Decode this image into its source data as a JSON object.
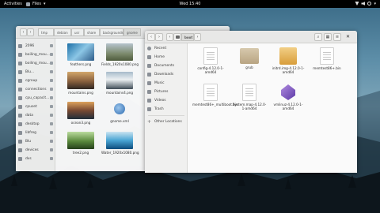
{
  "topbar": {
    "activities": "Activities",
    "app_menu": "Files",
    "clock": "Wed 15:40"
  },
  "back_window": {
    "path": [
      "tmp",
      "debian",
      "usr",
      "share",
      "backgrounds",
      "gnome"
    ],
    "sidebar": [
      "2096",
      "boiling_mou...",
      "boiling_mou...",
      "Blu...",
      "cgroup",
      "connections",
      "cpu_capacit...",
      "cpuset",
      "data",
      "desktop",
      "libfreg",
      "Blu",
      "devices",
      "dvs"
    ],
    "files": [
      {
        "name": "feathers.png",
        "icon": "image-feathers"
      },
      {
        "name": "Fields_1920x1080.png",
        "icon": "image-fields"
      },
      {
        "name": "mountains.png",
        "icon": "image-mountains"
      },
      {
        "name": "mountains4.png",
        "icon": "image-mountains4"
      },
      {
        "name": "ocean3.png",
        "icon": "image-ocean"
      },
      {
        "name": "gnome.xml",
        "icon": "xml-file"
      },
      {
        "name": "tree2.png",
        "icon": "image-tree"
      },
      {
        "name": "Water_1920x1080.png",
        "icon": "image-water"
      }
    ]
  },
  "front_window": {
    "path": [
      "boot"
    ],
    "sidebar": [
      {
        "label": "Recent",
        "icon": "clock-icon"
      },
      {
        "label": "Home",
        "icon": "home-icon"
      },
      {
        "label": "Documents",
        "icon": "documents-icon"
      },
      {
        "label": "Downloads",
        "icon": "downloads-icon"
      },
      {
        "label": "Music",
        "icon": "music-icon"
      },
      {
        "label": "Pictures",
        "icon": "pictures-icon"
      },
      {
        "label": "Videos",
        "icon": "videos-icon"
      },
      {
        "label": "Trash",
        "icon": "trash-icon"
      },
      {
        "label": "Other Locations",
        "icon": "plus-icon"
      }
    ],
    "files": [
      {
        "name": "config-4.12.0-1-amd64",
        "icon": "text-file"
      },
      {
        "name": "grub",
        "icon": "folder"
      },
      {
        "name": "initrd.img-4.12.0-1-amd64",
        "icon": "archive"
      },
      {
        "name": "memtest86+.bin",
        "icon": "text-file"
      },
      {
        "name": "memtest86+_multiboot.bin",
        "icon": "text-file"
      },
      {
        "name": "System.map-4.12.0-1-amd64",
        "icon": "text-file"
      },
      {
        "name": "vmlinuz-4.12.0-1-amd64",
        "icon": "kernel"
      }
    ]
  }
}
